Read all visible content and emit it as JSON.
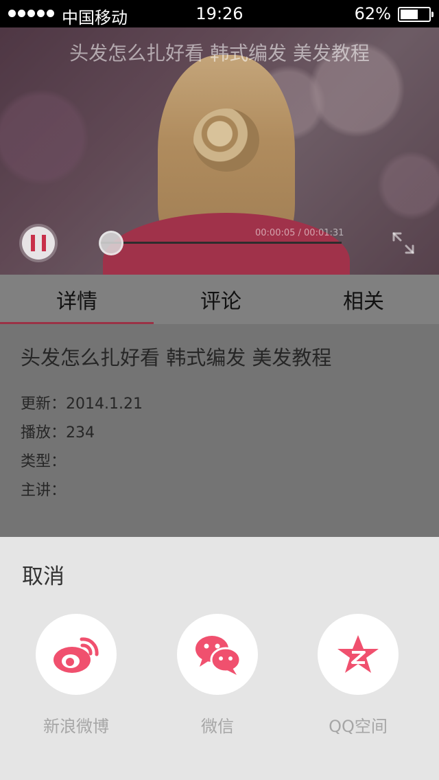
{
  "status_bar": {
    "carrier": "中国移动",
    "time": "19:26",
    "battery": "62%",
    "battery_level": 0.62
  },
  "video": {
    "title": "头发怎么扎好看 韩式编发 美发教程",
    "timecode": "00:00:05 / 00:01:31",
    "progress": 0.05
  },
  "tabs": [
    {
      "label": "详情",
      "active": true
    },
    {
      "label": "评论",
      "active": false
    },
    {
      "label": "相关",
      "active": false
    }
  ],
  "details": {
    "title": "头发怎么扎好看 韩式编发 美发教程",
    "meta": [
      {
        "label": "更新：",
        "value": "2014.1.21"
      },
      {
        "label": "播放：",
        "value": "234"
      },
      {
        "label": "类型：",
        "value": ""
      },
      {
        "label": "主讲：",
        "value": ""
      }
    ]
  },
  "share": {
    "cancel": "取消",
    "items": [
      {
        "label": "新浪微博",
        "icon": "weibo-icon"
      },
      {
        "label": "微信",
        "icon": "wechat-icon"
      },
      {
        "label": "QQ空间",
        "icon": "qzone-icon"
      }
    ]
  },
  "colors": {
    "accent": "#f0506e",
    "tab_indicator": "#9b3246"
  }
}
